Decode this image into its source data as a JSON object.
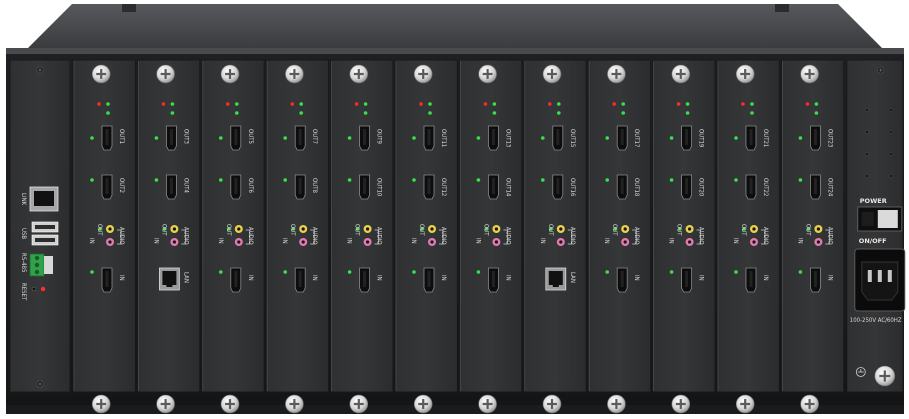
{
  "device": {
    "io_card_labels": {
      "out_pairs": [
        [
          "OUT1",
          "OUT2"
        ],
        [
          "OUT3",
          "OUT4"
        ],
        [
          "OUT5",
          "OUT6"
        ],
        [
          "OUT7",
          "OUT8"
        ],
        [
          "OUT9",
          "OUT10"
        ],
        [
          "OUT11",
          "OUT12"
        ],
        [
          "OUT13",
          "OUT14"
        ],
        [
          "OUT15",
          "OUT16"
        ],
        [
          "OUT17",
          "OUT18"
        ],
        [
          "OUT19",
          "OUT20"
        ],
        [
          "OUT21",
          "OUT22"
        ],
        [
          "OUT23",
          "OUT24"
        ]
      ],
      "audio": "AUDIO",
      "audio_in": "IN",
      "audio_out": "OUT",
      "hdmi_in": "IN",
      "lan": "LAN"
    },
    "control_card": {
      "link": "LINK",
      "usb": "USB",
      "rs485": "RS-485",
      "reset": "RESET"
    },
    "power_card": {
      "power": "POWER",
      "on_off": "ON/OFF",
      "rating": "100-250V AC/60HZ"
    },
    "lan_cards": [
      1,
      7
    ],
    "colors": {
      "chassis": "#3a3b3d",
      "panel": "#2a2b2d",
      "led_red": "#ff2a2a",
      "led_green": "#39e04a",
      "audio_yellow": "#e8d24a",
      "audio_pink": "#e37ab0",
      "terminal_green": "#2fa24a"
    }
  }
}
